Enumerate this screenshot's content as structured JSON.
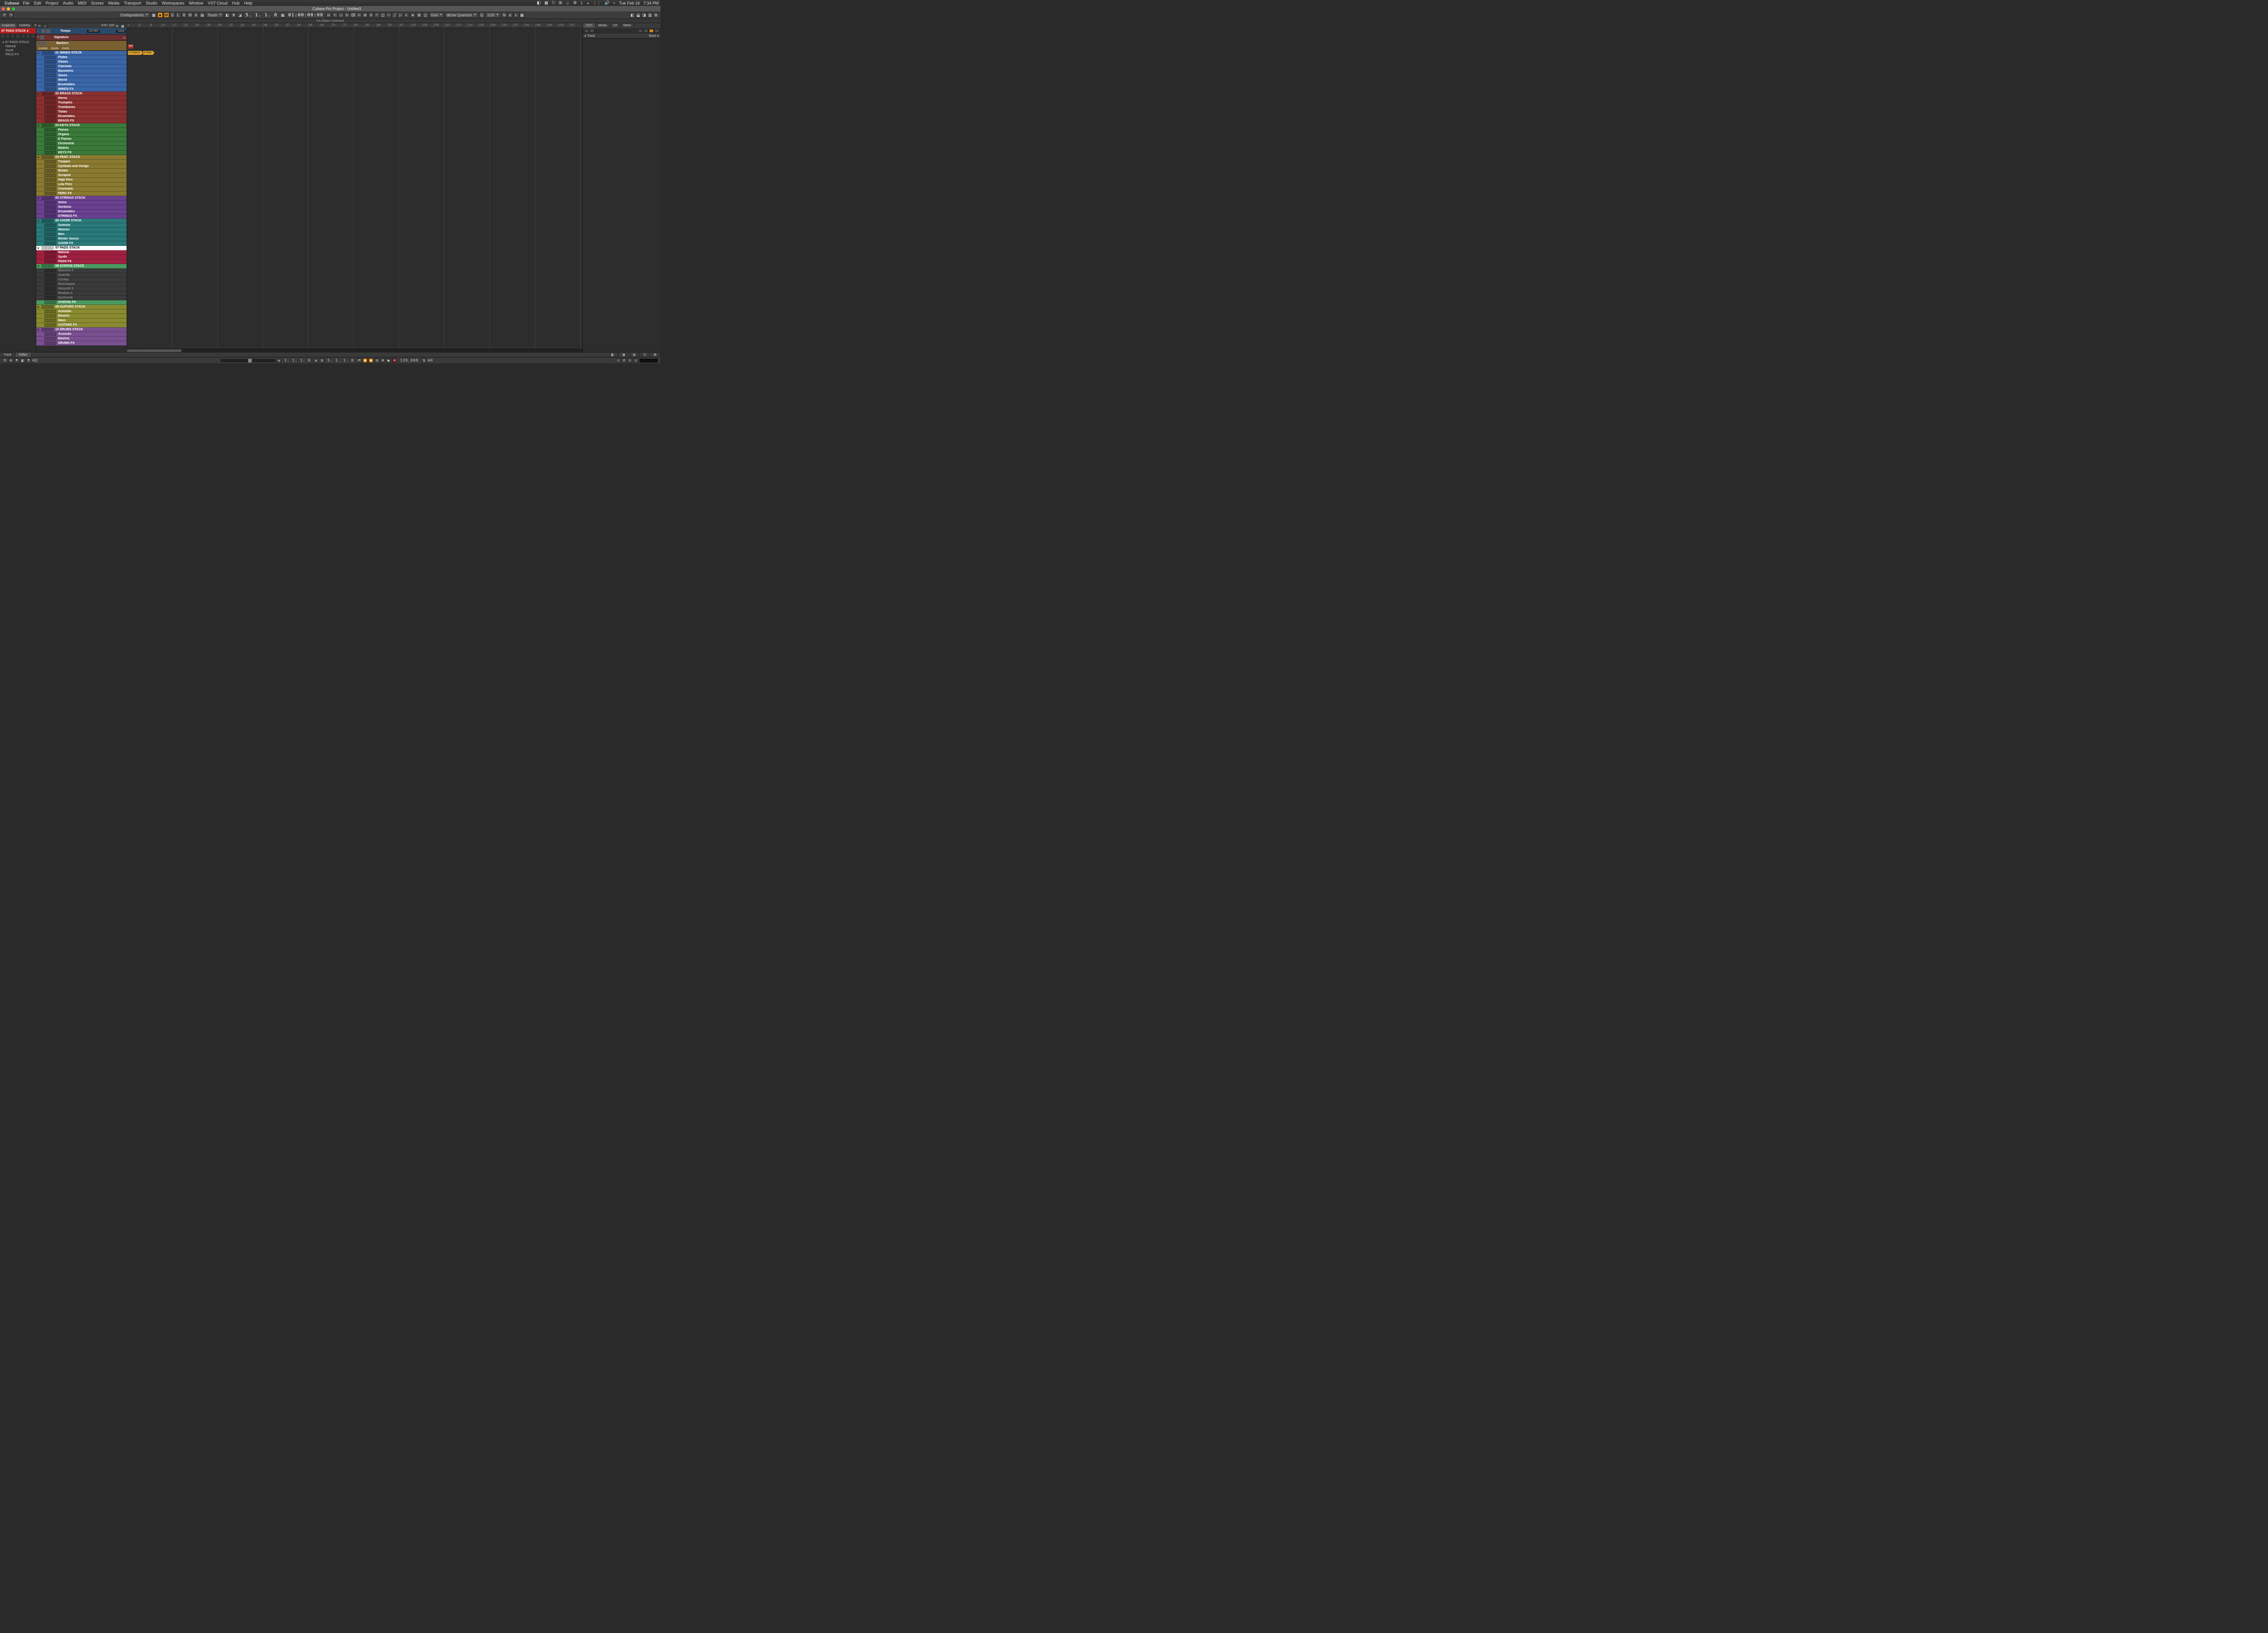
{
  "mac_menu": {
    "app": "Cubase",
    "items": [
      "File",
      "Edit",
      "Project",
      "Audio",
      "MIDI",
      "Scores",
      "Media",
      "Transport",
      "Studio",
      "Workspaces",
      "Window",
      "VST Cloud",
      "Hub",
      "Help"
    ],
    "right": {
      "date": "Tue Feb 16",
      "time": "7:34 PM"
    }
  },
  "window": {
    "title": "Cubase Pro Project - Untitled1",
    "traffic": {
      "close": "#ff5f57",
      "min": "#febc2e",
      "max": "#28c840"
    }
  },
  "toolbar": {
    "configurations": "Configurations",
    "state_btns": [
      "M",
      "S",
      "L",
      "R",
      "W",
      "A"
    ],
    "automation_mode": "Touch",
    "position_small": "5. 1. 1.   0",
    "timecode": "01:00:00:00",
    "snap_mode": "Grid",
    "quantize_label": "Use Quantize",
    "quantize_value": "1/16"
  },
  "info_strip": "No Object Selected",
  "left_panel": {
    "tabs": [
      "Inspector",
      "Visibility"
    ],
    "active_track": "07 PADS STACK e",
    "tree": {
      "parent": "07 PADS STACK",
      "children": [
        "Natural",
        "Synth",
        "PADS FX"
      ]
    }
  },
  "track_header": {
    "count": "478 / 320"
  },
  "special_tracks": {
    "tempo": {
      "name": "Tempo",
      "value": "120.000",
      "btn": "Jump"
    },
    "signature": {
      "name": "Signature"
    },
    "markers": {
      "name": "Markers",
      "btns": [
        "Locate",
        "Cycle",
        "Zoom"
      ]
    }
  },
  "ruler": {
    "start": 1,
    "step": 4,
    "count": 40
  },
  "arrange_events": {
    "signature": "4/4",
    "markers": [
      "2: Count In",
      "3: Start"
    ]
  },
  "colors": {
    "winds": "#3a66a8",
    "brass": "#8a3030",
    "keys": "#3a7a3a",
    "perc": "#8a7a30",
    "strings": "#6a4090",
    "choir": "#2a7a7a",
    "pads": "#a02040",
    "synths": "#4a9a60",
    "guitars": "#8a8a30",
    "drums": "#7a5090",
    "muted": "#3a3a3a"
  },
  "tracks": [
    {
      "type": "folder",
      "name": "01 WINDS STACK",
      "color": "winds"
    },
    {
      "type": "sub",
      "name": "Flutes",
      "color": "winds"
    },
    {
      "type": "sub",
      "name": "Oboes",
      "color": "winds"
    },
    {
      "type": "sub",
      "name": "Clarinets",
      "color": "winds"
    },
    {
      "type": "sub",
      "name": "Bassoons",
      "color": "winds"
    },
    {
      "type": "sub",
      "name": "Saxes",
      "color": "winds"
    },
    {
      "type": "sub",
      "name": "World",
      "color": "winds"
    },
    {
      "type": "sub",
      "name": "Ensembles",
      "color": "winds"
    },
    {
      "type": "sub",
      "name": "WINDS FX",
      "color": "winds"
    },
    {
      "type": "folder",
      "name": "02 BRASS STACK",
      "color": "brass"
    },
    {
      "type": "sub",
      "name": "Horns",
      "color": "brass"
    },
    {
      "type": "sub",
      "name": "Trumpets",
      "color": "brass"
    },
    {
      "type": "sub",
      "name": "Trombones",
      "color": "brass"
    },
    {
      "type": "sub",
      "name": "Tubas",
      "color": "brass"
    },
    {
      "type": "sub",
      "name": "Ensembles",
      "color": "brass"
    },
    {
      "type": "sub",
      "name": "BRASS FX",
      "color": "brass"
    },
    {
      "type": "folder",
      "name": "03 KEYS STACK",
      "color": "keys"
    },
    {
      "type": "sub",
      "name": "Pianos",
      "color": "keys"
    },
    {
      "type": "sub",
      "name": "Organs",
      "color": "keys"
    },
    {
      "type": "sub",
      "name": "E Pianos",
      "color": "keys"
    },
    {
      "type": "sub",
      "name": "Orchestral",
      "color": "keys"
    },
    {
      "type": "sub",
      "name": "Mallets",
      "color": "keys"
    },
    {
      "type": "sub",
      "name": "KEYS FX",
      "color": "keys"
    },
    {
      "type": "folder",
      "name": "04 PERC STACK",
      "color": "perc"
    },
    {
      "type": "sub",
      "name": "Timpani",
      "color": "perc"
    },
    {
      "type": "sub",
      "name": "Cymbals and Gongs",
      "color": "perc"
    },
    {
      "type": "sub",
      "name": "Metals",
      "color": "perc"
    },
    {
      "type": "sub",
      "name": "Scraped",
      "color": "perc"
    },
    {
      "type": "sub",
      "name": "High Perc",
      "color": "perc"
    },
    {
      "type": "sub",
      "name": "Low Perc",
      "color": "perc"
    },
    {
      "type": "sub",
      "name": "Cinematic",
      "color": "perc"
    },
    {
      "type": "sub",
      "name": "PERC FX",
      "color": "perc"
    },
    {
      "type": "folder",
      "name": "05 STRINGS STACK",
      "color": "strings"
    },
    {
      "type": "sub",
      "name": "Solos",
      "color": "strings"
    },
    {
      "type": "sub",
      "name": "Sections",
      "color": "strings"
    },
    {
      "type": "sub",
      "name": "Ensembles",
      "color": "strings"
    },
    {
      "type": "sub",
      "name": "STRINGS FX",
      "color": "strings"
    },
    {
      "type": "folder",
      "name": "06 CHOIR STACK",
      "color": "choir"
    },
    {
      "type": "sub",
      "name": "Soloists",
      "color": "choir"
    },
    {
      "type": "sub",
      "name": "Women",
      "color": "choir"
    },
    {
      "type": "sub",
      "name": "Men",
      "color": "choir"
    },
    {
      "type": "sub",
      "name": "Winter Voices",
      "color": "choir"
    },
    {
      "type": "sub",
      "name": "CHOIR FX",
      "color": "choir"
    },
    {
      "type": "folder",
      "name": "07 PADS STACK",
      "color": "pads",
      "selected": true
    },
    {
      "type": "sub",
      "name": "Natural",
      "color": "pads"
    },
    {
      "type": "sub",
      "name": "Synth",
      "color": "pads"
    },
    {
      "type": "sub",
      "name": "PADS FX",
      "color": "pads"
    },
    {
      "type": "folder",
      "name": "08 SYNTHS STACK",
      "color": "synths"
    },
    {
      "type": "sub",
      "name": "Massive X",
      "color": "muted",
      "muted": true
    },
    {
      "type": "sub",
      "name": "Aparillo",
      "color": "muted",
      "muted": true
    },
    {
      "type": "sub",
      "name": "Cyclop",
      "color": "muted",
      "muted": true
    },
    {
      "type": "sub",
      "name": "Retrologue",
      "color": "muted",
      "muted": true
    },
    {
      "type": "sub",
      "name": "Absynth 5",
      "color": "muted",
      "muted": true
    },
    {
      "type": "sub",
      "name": "Reaktor 6",
      "color": "muted",
      "muted": true
    },
    {
      "type": "sub",
      "name": "Syntronik",
      "color": "muted",
      "muted": true
    },
    {
      "type": "sub",
      "name": "SYNTHS FX",
      "color": "synths"
    },
    {
      "type": "folder",
      "name": "09 GUITARS STACK",
      "color": "guitars"
    },
    {
      "type": "sub",
      "name": "Acoustic",
      "color": "guitars"
    },
    {
      "type": "sub",
      "name": "Electric",
      "color": "guitars"
    },
    {
      "type": "sub",
      "name": "Bass",
      "color": "guitars"
    },
    {
      "type": "sub",
      "name": "GUITARS FX",
      "color": "guitars"
    },
    {
      "type": "folder",
      "name": "10 DRUMS STACK",
      "color": "drums"
    },
    {
      "type": "sub",
      "name": "Acoustic",
      "color": "drums"
    },
    {
      "type": "sub",
      "name": "Electric",
      "color": "drums"
    },
    {
      "type": "sub",
      "name": "DRUMS FX",
      "color": "drums"
    }
  ],
  "right_panel": {
    "tabs": [
      "VSTi",
      "Media",
      "CR",
      "Meter"
    ],
    "track_label": "Track",
    "rack_label": "Rack"
  },
  "bottom_tabs": {
    "left": [
      "Track",
      "Editor"
    ]
  },
  "transport": {
    "aq": "AQ",
    "primary_pos": "1. 1. 1.   0",
    "secondary_pos": "5. 1. 1.   0",
    "tempo": "120.000",
    "signature": "4/4"
  }
}
